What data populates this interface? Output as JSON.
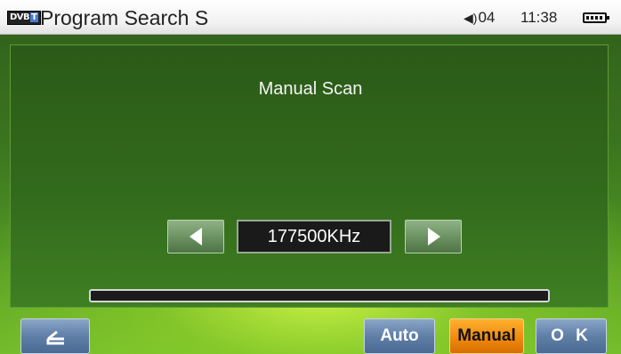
{
  "status_bar": {
    "logo_text": "DVB",
    "logo_suffix": "T",
    "title": "Program Search S",
    "volume": "04",
    "time": "11:38"
  },
  "dialog": {
    "title": "Manual Scan",
    "frequency": "177500KHz",
    "scan_progress": 0
  },
  "buttons": {
    "auto": "Auto",
    "manual": "Manual",
    "ok": "O K"
  },
  "icons": {
    "back": "back-arrow-icon",
    "prev": "triangle-left-icon",
    "next": "triangle-right-icon",
    "volume": "speaker-icon",
    "battery": "battery-icon"
  },
  "colors": {
    "accent_orange": "#f08a10",
    "button_blue": "#5f7fa7",
    "background_green": "#3b741f"
  }
}
